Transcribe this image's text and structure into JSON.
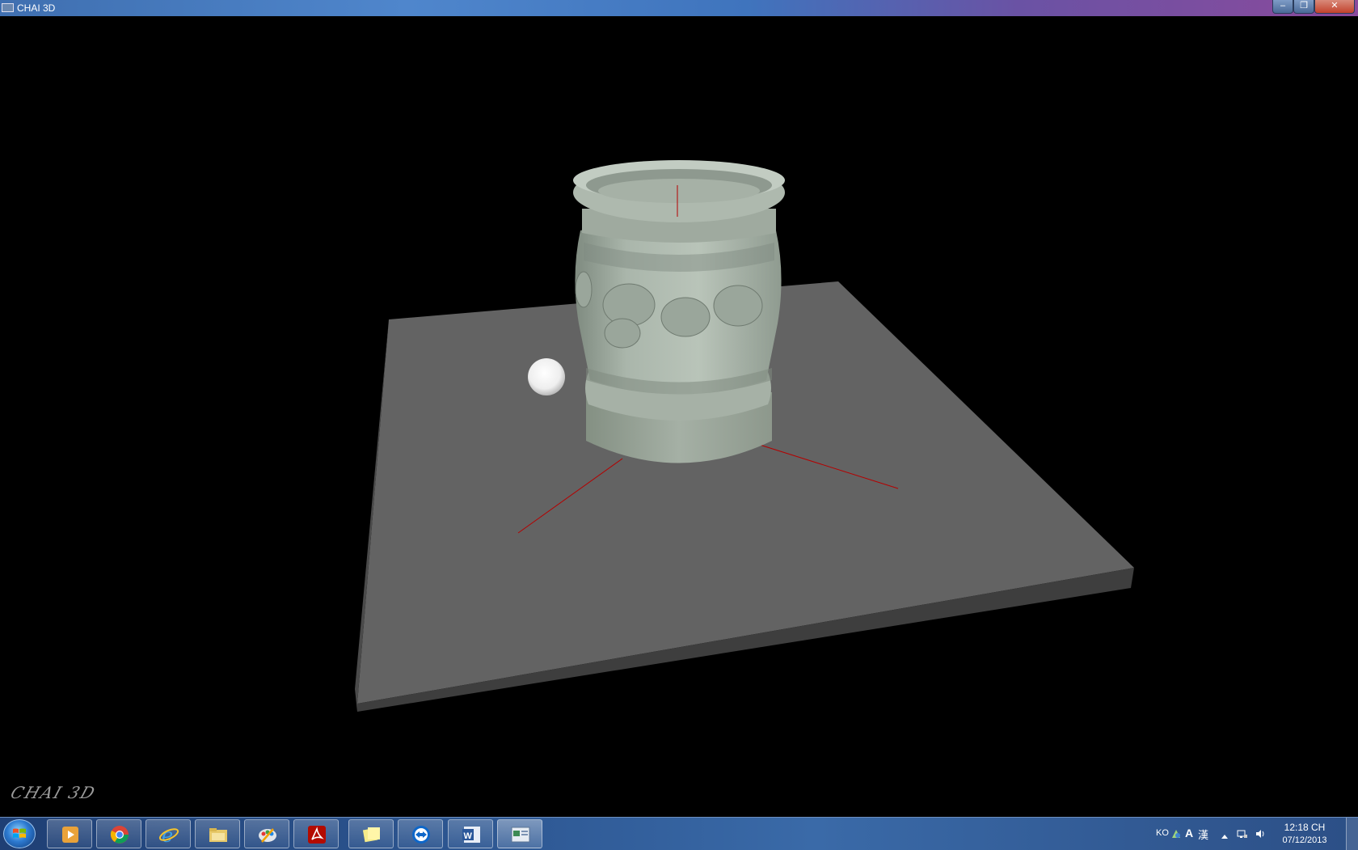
{
  "window": {
    "title": "CHAI 3D",
    "min_symbol": "–",
    "max_symbol": "❐",
    "close_symbol": "✕"
  },
  "viewport": {
    "logo_text": "CHAI 3D",
    "colors": {
      "background": "#000000",
      "ground_plane": "#636363",
      "vase": "#a9b4aa",
      "sphere": "#ffffff",
      "axes": "#c00000"
    }
  },
  "taskbar": {
    "start_icon": "windows-start-icon",
    "pinned": [
      {
        "name": "media-player-icon"
      },
      {
        "name": "chrome-icon"
      },
      {
        "name": "internet-explorer-icon"
      },
      {
        "name": "file-explorer-icon"
      },
      {
        "name": "paint-icon"
      },
      {
        "name": "acrobat-reader-icon"
      },
      {
        "name": "sticky-notes-icon"
      },
      {
        "name": "teamviewer-icon"
      },
      {
        "name": "word-icon"
      },
      {
        "name": "chai3d-app-icon"
      }
    ],
    "tray": {
      "input_lang": "KO",
      "ime_a": "A",
      "ime_han": "漢",
      "time": "12:18 CH",
      "date": "07/12/2013"
    }
  }
}
